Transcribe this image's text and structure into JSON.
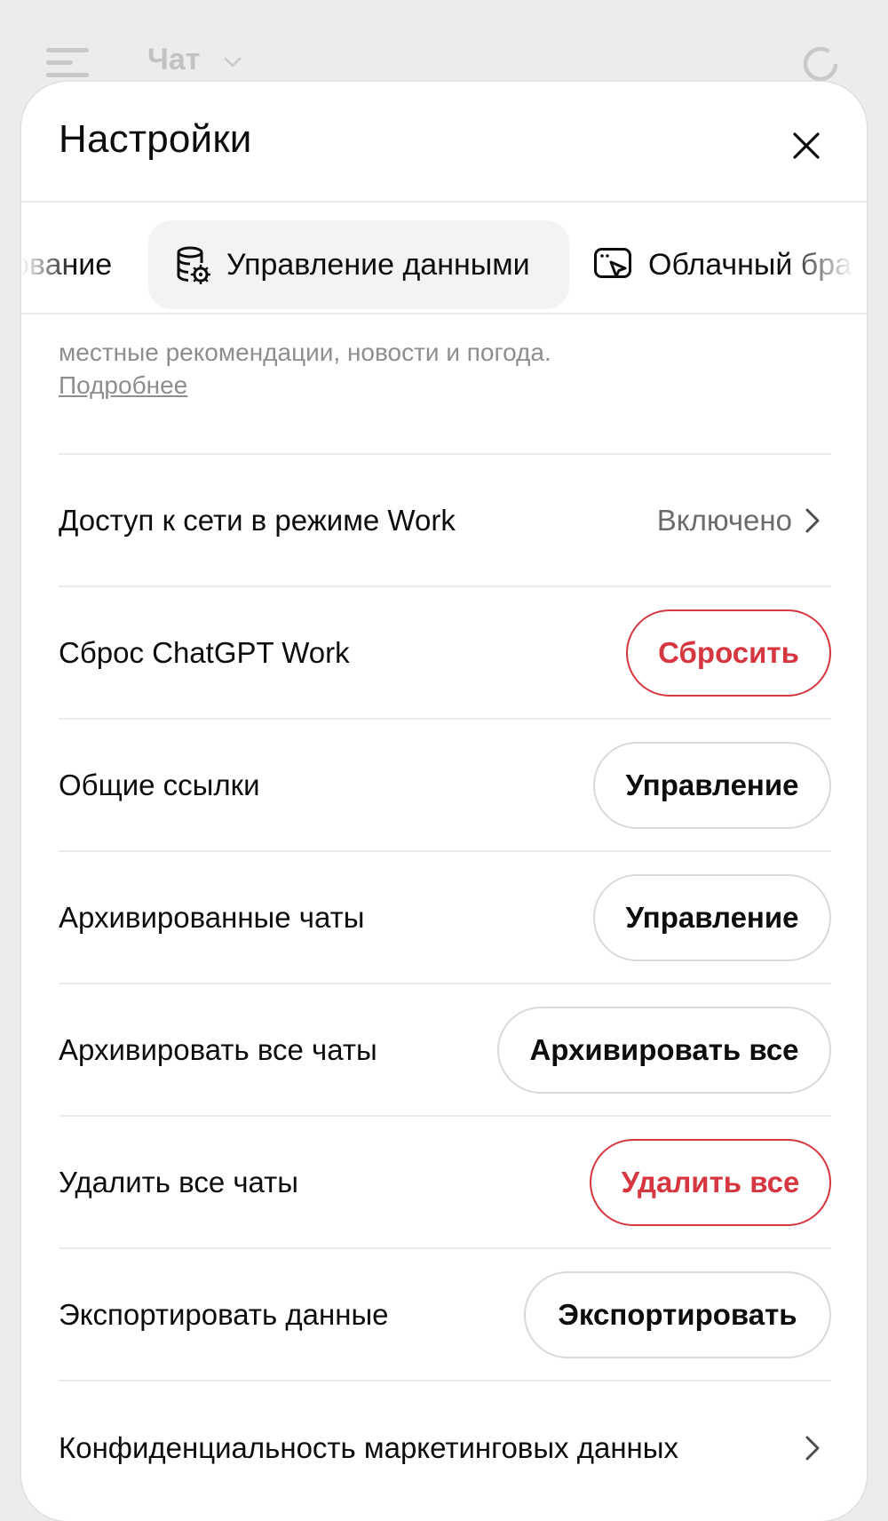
{
  "background": {
    "title": "Чат"
  },
  "sheet": {
    "title": "Настройки"
  },
  "tabs": [
    {
      "label": "ование",
      "icon": "none"
    },
    {
      "label": "Управление данными",
      "icon": "database-gear-icon",
      "active": true
    },
    {
      "label": "Облачный бра",
      "icon": "browser-cursor-icon"
    }
  ],
  "partial_text": {
    "text": "местные рекомендации, новости и погода.",
    "link": "Подробнее"
  },
  "rows": [
    {
      "label": "Доступ к сети в режиме Work",
      "value": "Включено"
    },
    {
      "label": "Сброс ChatGPT Work",
      "button": "Сбросить"
    },
    {
      "label": "Общие ссылки",
      "button": "Управление"
    },
    {
      "label": "Архивированные чаты",
      "button": "Управление"
    },
    {
      "label": "Архивировать все чаты",
      "button": "Архивировать все"
    },
    {
      "label": "Удалить все чаты",
      "button": "Удалить все"
    },
    {
      "label": "Экспортировать данные",
      "button": "Экспортировать"
    },
    {
      "label": "Конфиденциальность маркетинговых данных"
    }
  ],
  "colors": {
    "danger": "#d6363f",
    "border": "#d9d9d9",
    "muted_text": "#8e8e8e"
  }
}
